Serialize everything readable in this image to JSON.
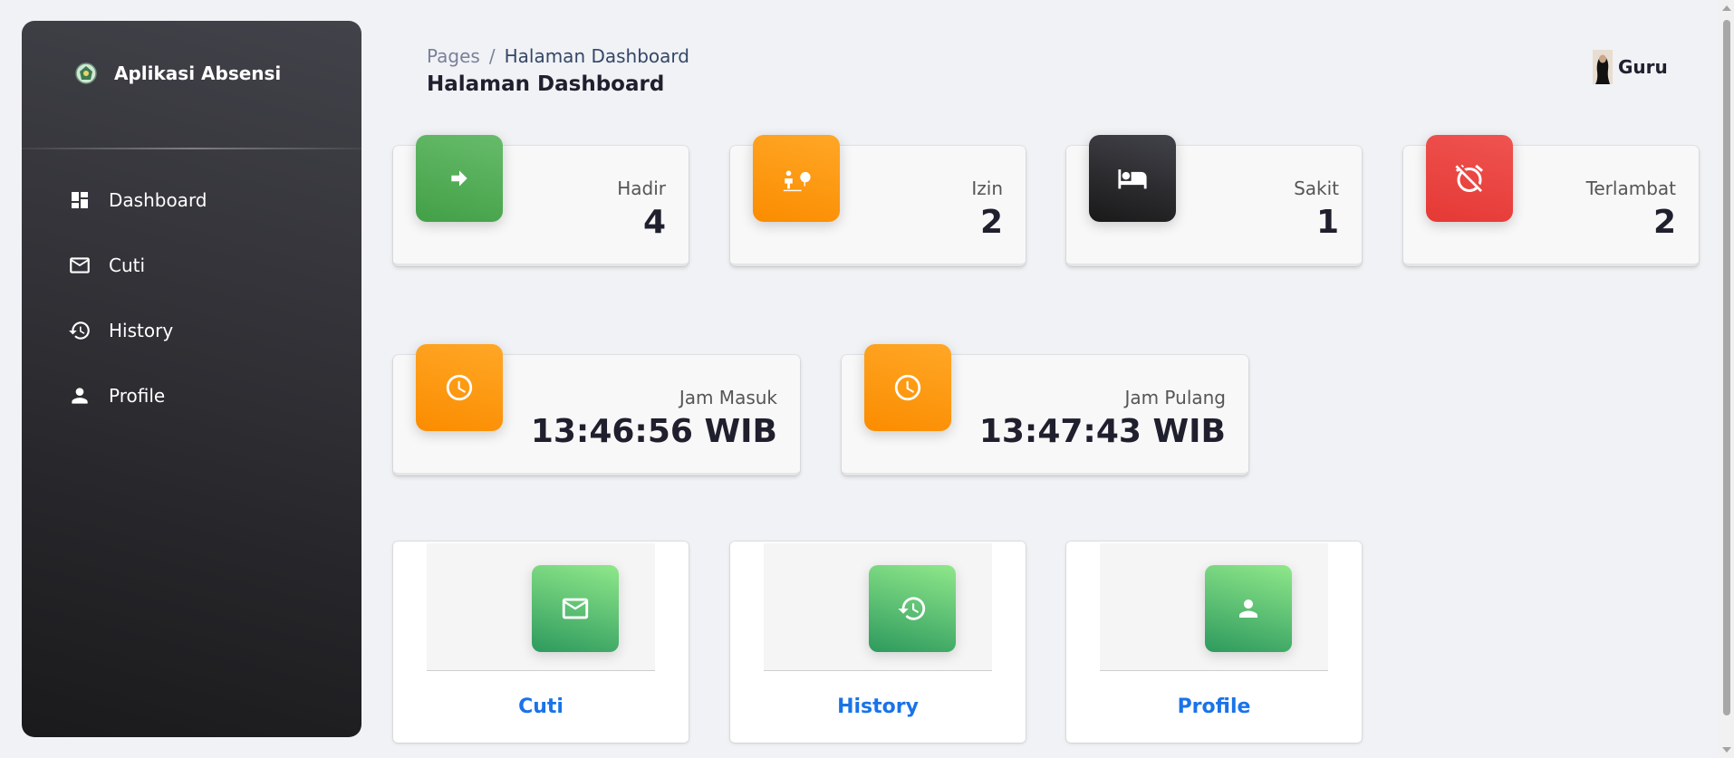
{
  "sidebar": {
    "brand": "Aplikasi Absensi",
    "items": [
      {
        "label": "Dashboard",
        "icon": "dashboard-icon"
      },
      {
        "label": "Cuti",
        "icon": "mail-icon"
      },
      {
        "label": "History",
        "icon": "history-icon"
      },
      {
        "label": "Profile",
        "icon": "person-icon"
      }
    ]
  },
  "header": {
    "breadcrumb_root": "Pages",
    "breadcrumb_separator": "/",
    "breadcrumb_current": "Halaman Dashboard",
    "title": "Halaman Dashboard",
    "user_name": "Guru"
  },
  "stats": [
    {
      "label": "Hadir",
      "value": "4",
      "icon": "arrow-right-icon",
      "color": "#4caf50"
    },
    {
      "label": "Izin",
      "value": "2",
      "icon": "person-tree-icon",
      "color": "#fb8c00"
    },
    {
      "label": "Sakit",
      "value": "1",
      "icon": "bed-icon",
      "color": "#262626"
    },
    {
      "label": "Terlambat",
      "value": "2",
      "icon": "alarm-off-icon",
      "color": "#e53935"
    }
  ],
  "times": [
    {
      "label": "Jam Masuk",
      "value": "13:46:56 WIB",
      "icon": "clock-icon",
      "color": "#fb8c00"
    },
    {
      "label": "Jam Pulang",
      "value": "13:47:43 WIB",
      "icon": "clock-icon",
      "color": "#fb8c00"
    }
  ],
  "links": [
    {
      "label": "Cuti",
      "icon": "mail-icon"
    },
    {
      "label": "History",
      "icon": "history-icon"
    },
    {
      "label": "Profile",
      "icon": "person-icon"
    }
  ],
  "colors": {
    "link": "#1a73e8",
    "link_icon_gradient": [
      "#8fe88a",
      "#2e9a5e"
    ]
  }
}
